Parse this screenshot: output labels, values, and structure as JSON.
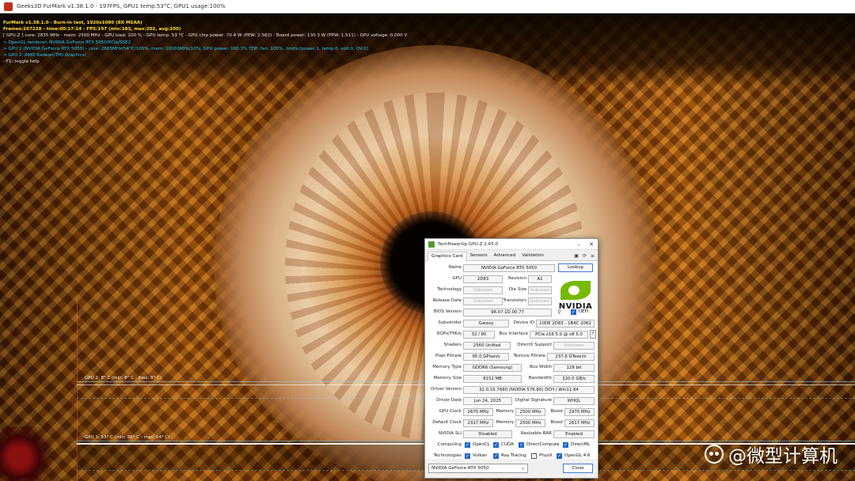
{
  "window": {
    "title": "Geeks3D FurMark v1.38.1.0 - 197FPS, GPU1 temp:53°C, GPU1 usage:100%"
  },
  "overlay": {
    "lines": [
      {
        "text": "FurMark v1.38.1.0 - Burn-in test, 1920x1080 (8X MSAA)",
        "color": "yellow"
      },
      {
        "text": "Frames:267228 - time:00:17:14 - FPS:197 (min:183, max:202, avg:200)",
        "color": "yellow"
      },
      {
        "text": "[ GPU-Z ] core: 2835 MHz - mem: 2500 MHz - GPU load: 100 % - GPU temp: 53 °C - GPU chip power: 70.4 W (PPW: 2.582) - Board power: 130.3 W (PPW: 1.511) - GPU voltage: 0.000 V",
        "color": "white"
      },
      {
        "text": "> OpenGL renderer: NVIDIA GeForce RTX 5050/PCIe/SSE2",
        "color": "cyan"
      },
      {
        "text": "> GPU 1 (NVIDIA GeForce RTX 5050) - core: 2865MHz/54°C/100%, mem: 10000MHz/10%, GPU power: 100.3% TDP, fan: 100%, limits:[power:1, temp:0, volt:0, OV:0]",
        "color": "cyan"
      },
      {
        "text": "> GPU 2 (AMD Radeon(TM) Graphics)",
        "color": "cyan"
      },
      {
        "text": "- F1: toggle help",
        "color": "white"
      }
    ]
  },
  "graphs": [
    {
      "label": "GPU 2: 8° C (min: 8° C - max: 8° C)"
    },
    {
      "label": "GPU 1: 53° C (min: 36° C - max: 54° C)"
    }
  ],
  "watermark": "@微型计算机",
  "gpuz": {
    "title": "TechPowerUp GPU-Z 2.65.0",
    "tabs": [
      "Graphics Card",
      "Sensors",
      "Advanced",
      "Validation"
    ],
    "lookup_label": "Lookup",
    "uefi_label": "UEFI",
    "logo_text": "NVIDIA",
    "fields": {
      "name": {
        "label": "Name",
        "value": "NVIDIA GeForce RTX 5050"
      },
      "gpu": {
        "label": "GPU",
        "value": "2D83"
      },
      "revision": {
        "label": "Revision",
        "value": "A1"
      },
      "technology": {
        "label": "Technology",
        "value": "Unknown"
      },
      "die_size": {
        "label": "Die Size",
        "value": "Unknown"
      },
      "release_date": {
        "label": "Release Date",
        "value": "Unknown"
      },
      "transistors": {
        "label": "Transistors",
        "value": "Unknown"
      },
      "bios_version": {
        "label": "BIOS Version",
        "value": "98.07.1D.00.77"
      },
      "subvendor": {
        "label": "Subvendor",
        "value": "Galaxy"
      },
      "device_id": {
        "label": "Device ID",
        "value": "10DE 2D83 - 1B4C 2062"
      },
      "rops_tmus": {
        "label": "ROPs/TMUs",
        "value": "32 / 80"
      },
      "bus_interface": {
        "label": "Bus Interface",
        "value": "PCIe x16 5.0 @ x8 5.0"
      },
      "shaders": {
        "label": "Shaders",
        "value": "2560 Unified"
      },
      "directx_support": {
        "label": "DirectX Support",
        "value": "Unknown"
      },
      "pixel_fillrate": {
        "label": "Pixel Fillrate",
        "value": "95.0 GPixel/s"
      },
      "texture_fillrate": {
        "label": "Texture Fillrate",
        "value": "237.6 GTexel/s"
      },
      "memory_type": {
        "label": "Memory Type",
        "value": "GDDR6 (Samsung)"
      },
      "bus_width": {
        "label": "Bus Width",
        "value": "128 bit"
      },
      "memory_size": {
        "label": "Memory Size",
        "value": "8152 MB"
      },
      "bandwidth": {
        "label": "Bandwidth",
        "value": "320.0 GB/s"
      },
      "driver_version": {
        "label": "Driver Version",
        "value": "32.0.15.7680 (NVIDIA 576.80) DCH / Win11 64"
      },
      "driver_date": {
        "label": "Driver Date",
        "value": "Jun 24, 2025"
      },
      "digital_signature": {
        "label": "Digital Signature",
        "value": "WHQL"
      },
      "gpu_clock": {
        "label": "GPU Clock",
        "value": "2670 MHz"
      },
      "gpu_clock_memory": {
        "label": "Memory",
        "value": "2500 MHz"
      },
      "gpu_clock_boost": {
        "label": "Boost",
        "value": "2970 MHz"
      },
      "default_clock": {
        "label": "Default Clock",
        "value": "2317 MHz"
      },
      "default_clock_memory": {
        "label": "Memory",
        "value": "2500 MHz"
      },
      "default_clock_boost": {
        "label": "Boost",
        "value": "2617 MHz"
      },
      "nvidia_sli": {
        "label": "NVIDIA SLI",
        "value": "Disabled"
      },
      "resizable_bar": {
        "label": "Resizable BAR",
        "value": "Enabled"
      }
    },
    "computing": {
      "label": "Computing",
      "items": [
        {
          "name": "OpenCL",
          "checked": true
        },
        {
          "name": "CUDA",
          "checked": true
        },
        {
          "name": "DirectCompute",
          "checked": true
        },
        {
          "name": "DirectML",
          "checked": true
        }
      ]
    },
    "technologies": {
      "label": "Technologies",
      "items": [
        {
          "name": "Vulkan",
          "checked": true
        },
        {
          "name": "Ray Tracing",
          "checked": true
        },
        {
          "name": "PhysX",
          "checked": false
        },
        {
          "name": "OpenGL 4.6",
          "checked": true
        }
      ]
    },
    "card_select": "NVIDIA GeForce RTX 5050",
    "close_label": "Close",
    "colors": {
      "nvidia_green": "#76b900",
      "accent_blue": "#1f67c8"
    }
  }
}
